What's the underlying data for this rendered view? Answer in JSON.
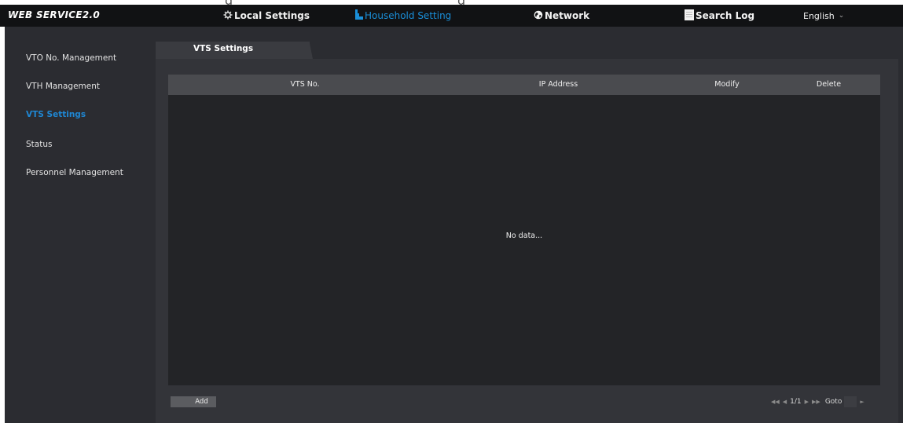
{
  "app": {
    "logo": "WEB SERVICE2.0"
  },
  "nav": {
    "items": [
      {
        "label": "Local Settings",
        "icon": "gear-icon"
      },
      {
        "label": "Household Setting",
        "icon": "household-icon"
      },
      {
        "label": "Network",
        "icon": "globe-icon"
      },
      {
        "label": "Search Log",
        "icon": "log-icon"
      }
    ],
    "active": "Household Setting",
    "language": "English"
  },
  "sidebar": {
    "items": [
      {
        "label": "VTO No. Management"
      },
      {
        "label": "VTH Management"
      },
      {
        "label": "VTS Settings"
      },
      {
        "label": "Status"
      },
      {
        "label": "Personnel Management"
      }
    ],
    "active": "VTS Settings"
  },
  "main": {
    "tab": "VTS Settings",
    "table": {
      "columns": [
        "VTS No.",
        "IP Address",
        "Modify",
        "Delete"
      ],
      "rows": [],
      "empty_text": "No data..."
    },
    "add_label": "Add",
    "pager": {
      "page": "1/1",
      "goto_label": "Goto",
      "goto_value": ""
    }
  },
  "colors": {
    "topbar": "#111214",
    "page_bg": "#2b2c31",
    "table_bg": "#232427",
    "header_bg": "#4a4b4f",
    "accent": "#1a8fd9"
  }
}
